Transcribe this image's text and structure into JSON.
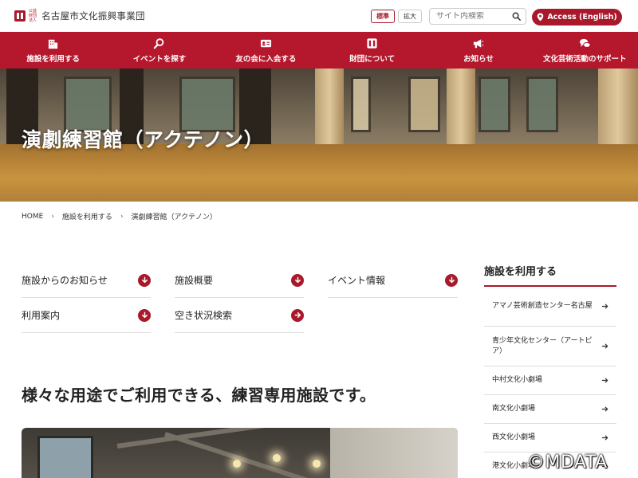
{
  "header": {
    "logo_small": "公益財団法人",
    "logo_name": "名古屋市文化振興事業団",
    "size_standard": "標準",
    "size_large": "拡大",
    "search_placeholder": "サイト内検索",
    "access_label": "Access (English)"
  },
  "nav": {
    "items": [
      {
        "label": "施設を利用する",
        "icon": "building-icon"
      },
      {
        "label": "イベントを探す",
        "icon": "search-icon"
      },
      {
        "label": "友の会に入会する",
        "icon": "member-card-icon"
      },
      {
        "label": "財団について",
        "icon": "logo-icon"
      },
      {
        "label": "お知らせ",
        "icon": "megaphone-icon"
      },
      {
        "label": "文化芸術活動のサポート",
        "icon": "chat-icon"
      }
    ]
  },
  "hero": {
    "title": "演劇練習館（アクテノン）"
  },
  "breadcrumb": {
    "home": "HOME",
    "level1": "施設を利用する",
    "current": "演劇練習館（アクテノン）"
  },
  "links": [
    {
      "label": "施設からのお知らせ",
      "icon": "arrow-down-icon"
    },
    {
      "label": "施設概要",
      "icon": "arrow-down-icon"
    },
    {
      "label": "イベント情報",
      "icon": "arrow-down-icon"
    },
    {
      "label": "利用案内",
      "icon": "arrow-down-icon"
    },
    {
      "label": "空き状況検索",
      "icon": "arrow-right-icon"
    }
  ],
  "main": {
    "heading": "様々な用途でご利用できる、練習専用施設です。"
  },
  "sidebar": {
    "title": "施設を利用する",
    "items": [
      {
        "label": "アマノ芸術創造センター名古屋"
      },
      {
        "label": "青少年文化センター（アートピア）"
      },
      {
        "label": "中村文化小劇場"
      },
      {
        "label": "南文化小劇場"
      },
      {
        "label": "西文化小劇場"
      },
      {
        "label": "港文化小劇場"
      }
    ]
  },
  "watermark": "©MDATA",
  "colors": {
    "accent": "#a8192c",
    "nav_bg": "#b5172c"
  }
}
